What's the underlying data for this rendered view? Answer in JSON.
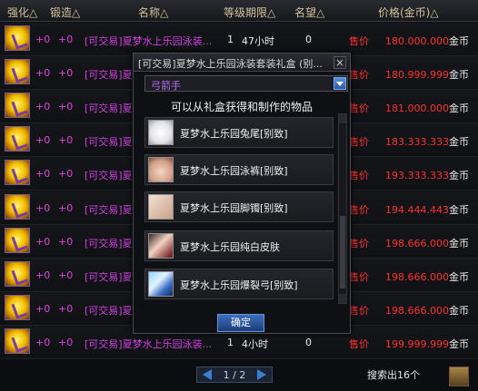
{
  "header": {
    "enhance": "强化△",
    "forge": "锻造△",
    "name": "名称△",
    "level": "等级期限△",
    "reputation": "名望△",
    "price": "价格(金币)△"
  },
  "rows": [
    {
      "enhance": "+0",
      "forge": "+0",
      "name": "[可交易]夏梦水上乐园泳装...",
      "level": "1",
      "time": "47小时",
      "rep": "0",
      "sell": "售价",
      "price": "180.000.000",
      "unit": "金币"
    },
    {
      "enhance": "+0",
      "forge": "+0",
      "name": "[可交易]夏梦水上乐园泳装...",
      "level": "",
      "time": "",
      "rep": "",
      "sell": "售价",
      "price": "180.999.999",
      "unit": "金币"
    },
    {
      "enhance": "+0",
      "forge": "+0",
      "name": "[可交易]夏梦水上乐园泳装...",
      "level": "",
      "time": "",
      "rep": "",
      "sell": "售价",
      "price": "181.000.000",
      "unit": "金币"
    },
    {
      "enhance": "+0",
      "forge": "+0",
      "name": "[可交易]夏梦水上乐园泳装...",
      "level": "",
      "time": "",
      "rep": "",
      "sell": "售价",
      "price": "183.333.333",
      "unit": "金币"
    },
    {
      "enhance": "+0",
      "forge": "+0",
      "name": "[可交易]夏梦水上乐园泳装...",
      "level": "",
      "time": "",
      "rep": "",
      "sell": "售价",
      "price": "193.333.333",
      "unit": "金币"
    },
    {
      "enhance": "+0",
      "forge": "+0",
      "name": "[可交易]夏梦水上乐园泳装...",
      "level": "",
      "time": "",
      "rep": "",
      "sell": "售价",
      "price": "194.444.443",
      "unit": "金币"
    },
    {
      "enhance": "+0",
      "forge": "+0",
      "name": "[可交易]夏梦水上乐园泳装...",
      "level": "",
      "time": "",
      "rep": "",
      "sell": "售价",
      "price": "198.666.000",
      "unit": "金币"
    },
    {
      "enhance": "+0",
      "forge": "+0",
      "name": "[可交易]夏梦水上乐园泳装...",
      "level": "",
      "time": "",
      "rep": "",
      "sell": "售价",
      "price": "198.666.000",
      "unit": "金币"
    },
    {
      "enhance": "+0",
      "forge": "+0",
      "name": "[可交易]夏梦水上乐园泳装...",
      "level": "",
      "time": "",
      "rep": "",
      "sell": "售价",
      "price": "198.666.000",
      "unit": "金币"
    },
    {
      "enhance": "+0",
      "forge": "+0",
      "name": "[可交易]夏梦水上乐园泳装...",
      "level": "1",
      "time": "4小时",
      "rep": "0",
      "sell": "售价",
      "price": "199.999.999",
      "unit": "金币"
    }
  ],
  "footer": {
    "page": "1 / 2",
    "search_result": "搜索出16个"
  },
  "popup": {
    "title": "[可交易]夏梦水上乐园泳装套装礼盒 (别...",
    "close": "×",
    "class_select": "弓箭手",
    "subtitle": "可以从礼盒获得和制作的物品",
    "items": [
      {
        "name": "夏梦水上乐园兔尾[别致]",
        "icon": "tail-icon"
      },
      {
        "name": "夏梦水上乐园泳裤[别致]",
        "icon": "swimsuit-icon"
      },
      {
        "name": "夏梦水上乐园脚镯[别致]",
        "icon": "anklet-icon"
      },
      {
        "name": "夏梦水上乐园纯白皮肤",
        "icon": "skin-icon"
      },
      {
        "name": "夏梦水上乐园爆裂弓[别致]",
        "icon": "bow-icon"
      }
    ],
    "confirm": "确定"
  },
  "colors": {
    "accent_purple": "#d040e0",
    "price_red": "#ff3030",
    "header_gold": "#d2c39a",
    "button_blue": "#3a6fbf"
  }
}
